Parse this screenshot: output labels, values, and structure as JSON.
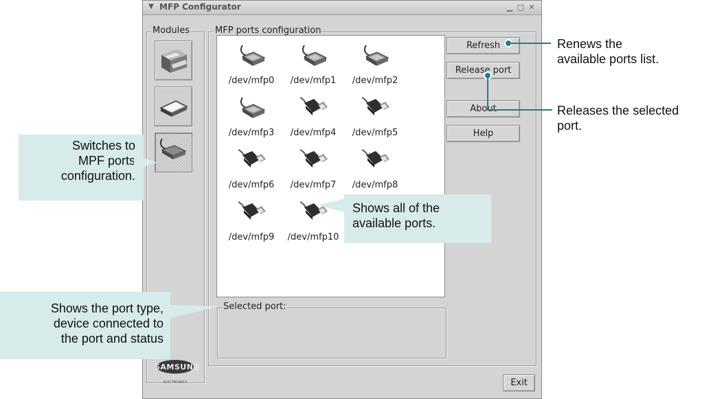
{
  "window": {
    "title": "MFP Configurator",
    "menu_icon": "chevron-down-icon",
    "controls": [
      "minimize-icon",
      "maximize-icon",
      "close-icon"
    ]
  },
  "modules": {
    "label": "Modules",
    "items": [
      {
        "name": "printer",
        "icon": "printer-icon"
      },
      {
        "name": "scanner",
        "icon": "scanner-icon"
      },
      {
        "name": "ports",
        "icon": "port-icon",
        "selected": true
      }
    ],
    "brand": {
      "name": "SAMSUNG",
      "sub": "ELECTRONICS"
    }
  },
  "ports_config": {
    "label": "MFP ports configuration",
    "ports": [
      {
        "label": "/dev/mfp0",
        "type": "parallel"
      },
      {
        "label": "/dev/mfp1",
        "type": "parallel"
      },
      {
        "label": "/dev/mfp2",
        "type": "parallel"
      },
      {
        "label": "/dev/mfp3",
        "type": "parallel"
      },
      {
        "label": "/dev/mfp4",
        "type": "usb"
      },
      {
        "label": "/dev/mfp5",
        "type": "usb"
      },
      {
        "label": "/dev/mfp6",
        "type": "usb"
      },
      {
        "label": "/dev/mfp7",
        "type": "usb"
      },
      {
        "label": "/dev/mfp8",
        "type": "usb"
      },
      {
        "label": "/dev/mfp9",
        "type": "usb"
      },
      {
        "label": "/dev/mfp10",
        "type": "usb"
      }
    ],
    "selected_label": "Selected port:"
  },
  "buttons": {
    "refresh": "Refresh",
    "release": "Release port",
    "about": "About",
    "help": "Help",
    "exit": "Exit"
  },
  "annotations": {
    "refresh": [
      "Renews the",
      "available ports list."
    ],
    "release": [
      "Releases the selected",
      "port."
    ],
    "modules": [
      "Switches to",
      "MPF ports",
      "configuration."
    ],
    "ports": [
      "Shows all of the",
      "available ports."
    ],
    "selected": [
      "Shows the port type,",
      "device connected to",
      "the port and status"
    ]
  },
  "colors": {
    "callout_bg": "#d6ebea",
    "marker": "#1f7f86"
  }
}
